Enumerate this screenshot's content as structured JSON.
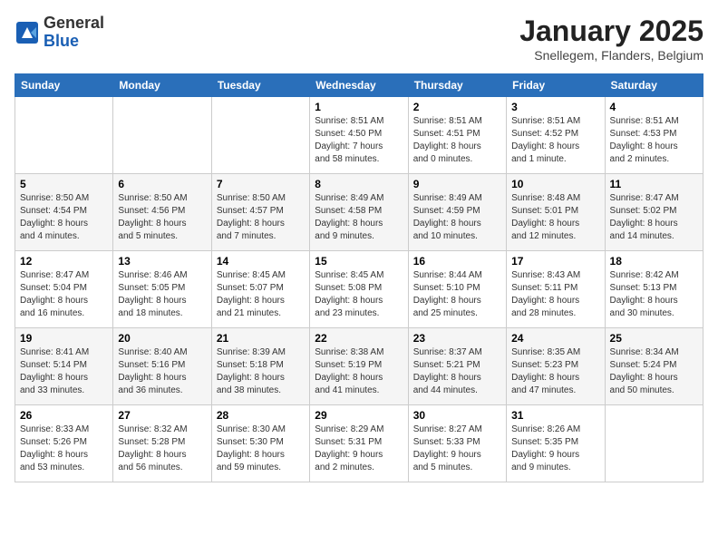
{
  "header": {
    "logo_line1": "General",
    "logo_line2": "Blue",
    "month_title": "January 2025",
    "location": "Snellegem, Flanders, Belgium"
  },
  "weekdays": [
    "Sunday",
    "Monday",
    "Tuesday",
    "Wednesday",
    "Thursday",
    "Friday",
    "Saturday"
  ],
  "weeks": [
    [
      {
        "day": "",
        "info": ""
      },
      {
        "day": "",
        "info": ""
      },
      {
        "day": "",
        "info": ""
      },
      {
        "day": "1",
        "info": "Sunrise: 8:51 AM\nSunset: 4:50 PM\nDaylight: 7 hours\nand 58 minutes."
      },
      {
        "day": "2",
        "info": "Sunrise: 8:51 AM\nSunset: 4:51 PM\nDaylight: 8 hours\nand 0 minutes."
      },
      {
        "day": "3",
        "info": "Sunrise: 8:51 AM\nSunset: 4:52 PM\nDaylight: 8 hours\nand 1 minute."
      },
      {
        "day": "4",
        "info": "Sunrise: 8:51 AM\nSunset: 4:53 PM\nDaylight: 8 hours\nand 2 minutes."
      }
    ],
    [
      {
        "day": "5",
        "info": "Sunrise: 8:50 AM\nSunset: 4:54 PM\nDaylight: 8 hours\nand 4 minutes."
      },
      {
        "day": "6",
        "info": "Sunrise: 8:50 AM\nSunset: 4:56 PM\nDaylight: 8 hours\nand 5 minutes."
      },
      {
        "day": "7",
        "info": "Sunrise: 8:50 AM\nSunset: 4:57 PM\nDaylight: 8 hours\nand 7 minutes."
      },
      {
        "day": "8",
        "info": "Sunrise: 8:49 AM\nSunset: 4:58 PM\nDaylight: 8 hours\nand 9 minutes."
      },
      {
        "day": "9",
        "info": "Sunrise: 8:49 AM\nSunset: 4:59 PM\nDaylight: 8 hours\nand 10 minutes."
      },
      {
        "day": "10",
        "info": "Sunrise: 8:48 AM\nSunset: 5:01 PM\nDaylight: 8 hours\nand 12 minutes."
      },
      {
        "day": "11",
        "info": "Sunrise: 8:47 AM\nSunset: 5:02 PM\nDaylight: 8 hours\nand 14 minutes."
      }
    ],
    [
      {
        "day": "12",
        "info": "Sunrise: 8:47 AM\nSunset: 5:04 PM\nDaylight: 8 hours\nand 16 minutes."
      },
      {
        "day": "13",
        "info": "Sunrise: 8:46 AM\nSunset: 5:05 PM\nDaylight: 8 hours\nand 18 minutes."
      },
      {
        "day": "14",
        "info": "Sunrise: 8:45 AM\nSunset: 5:07 PM\nDaylight: 8 hours\nand 21 minutes."
      },
      {
        "day": "15",
        "info": "Sunrise: 8:45 AM\nSunset: 5:08 PM\nDaylight: 8 hours\nand 23 minutes."
      },
      {
        "day": "16",
        "info": "Sunrise: 8:44 AM\nSunset: 5:10 PM\nDaylight: 8 hours\nand 25 minutes."
      },
      {
        "day": "17",
        "info": "Sunrise: 8:43 AM\nSunset: 5:11 PM\nDaylight: 8 hours\nand 28 minutes."
      },
      {
        "day": "18",
        "info": "Sunrise: 8:42 AM\nSunset: 5:13 PM\nDaylight: 8 hours\nand 30 minutes."
      }
    ],
    [
      {
        "day": "19",
        "info": "Sunrise: 8:41 AM\nSunset: 5:14 PM\nDaylight: 8 hours\nand 33 minutes."
      },
      {
        "day": "20",
        "info": "Sunrise: 8:40 AM\nSunset: 5:16 PM\nDaylight: 8 hours\nand 36 minutes."
      },
      {
        "day": "21",
        "info": "Sunrise: 8:39 AM\nSunset: 5:18 PM\nDaylight: 8 hours\nand 38 minutes."
      },
      {
        "day": "22",
        "info": "Sunrise: 8:38 AM\nSunset: 5:19 PM\nDaylight: 8 hours\nand 41 minutes."
      },
      {
        "day": "23",
        "info": "Sunrise: 8:37 AM\nSunset: 5:21 PM\nDaylight: 8 hours\nand 44 minutes."
      },
      {
        "day": "24",
        "info": "Sunrise: 8:35 AM\nSunset: 5:23 PM\nDaylight: 8 hours\nand 47 minutes."
      },
      {
        "day": "25",
        "info": "Sunrise: 8:34 AM\nSunset: 5:24 PM\nDaylight: 8 hours\nand 50 minutes."
      }
    ],
    [
      {
        "day": "26",
        "info": "Sunrise: 8:33 AM\nSunset: 5:26 PM\nDaylight: 8 hours\nand 53 minutes."
      },
      {
        "day": "27",
        "info": "Sunrise: 8:32 AM\nSunset: 5:28 PM\nDaylight: 8 hours\nand 56 minutes."
      },
      {
        "day": "28",
        "info": "Sunrise: 8:30 AM\nSunset: 5:30 PM\nDaylight: 8 hours\nand 59 minutes."
      },
      {
        "day": "29",
        "info": "Sunrise: 8:29 AM\nSunset: 5:31 PM\nDaylight: 9 hours\nand 2 minutes."
      },
      {
        "day": "30",
        "info": "Sunrise: 8:27 AM\nSunset: 5:33 PM\nDaylight: 9 hours\nand 5 minutes."
      },
      {
        "day": "31",
        "info": "Sunrise: 8:26 AM\nSunset: 5:35 PM\nDaylight: 9 hours\nand 9 minutes."
      },
      {
        "day": "",
        "info": ""
      }
    ]
  ]
}
